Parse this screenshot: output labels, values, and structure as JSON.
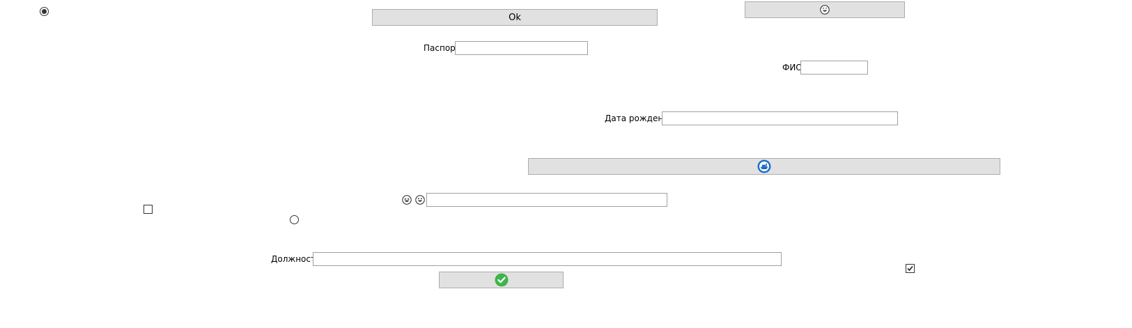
{
  "ok_button": {
    "label": "Ok"
  },
  "passport": {
    "label": "Паспорт",
    "value": ""
  },
  "fio": {
    "label": "ФИО",
    "value": ""
  },
  "birth_date": {
    "label": "Дата рождения",
    "value": ""
  },
  "position": {
    "label": "Должность",
    "value": ""
  },
  "emoji_field": {
    "value": ""
  },
  "radio_top": {
    "checked": true
  },
  "radio_mid": {
    "checked": false
  },
  "checkbox_left": {
    "checked": false
  },
  "checkbox_right": {
    "checked": true
  },
  "icons": {
    "emoji_button": "grinning-face-icon",
    "wide_button": "ship-badge-icon",
    "confirm_button": "green-checkmark-icon",
    "field_prefix": [
      "laughing-face-icon",
      "grinning-face-icon"
    ]
  },
  "colors": {
    "button_bg": "#e1e1e1",
    "button_border": "#adadad",
    "field_border": "#a0a0a0",
    "accent_blue": "#1e6fc8",
    "accent_green": "#3cb54a"
  }
}
